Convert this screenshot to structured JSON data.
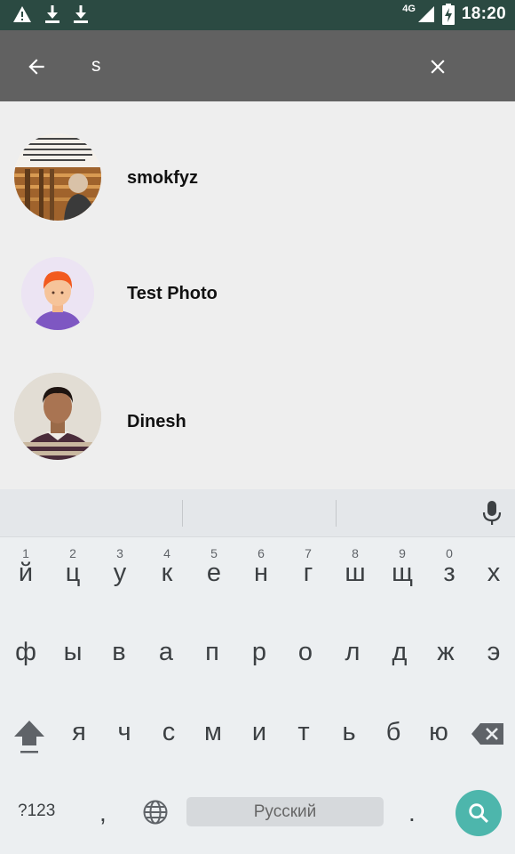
{
  "status_bar": {
    "network": "4G",
    "time": "18:20",
    "left_icons": [
      "warning-icon",
      "download-icon",
      "download-icon"
    ],
    "right_icons": [
      "signal-icon",
      "battery-charging-icon"
    ]
  },
  "toolbar": {
    "query": "s",
    "back_icon": "arrow-back-icon",
    "clear_icon": "close-icon"
  },
  "results": [
    {
      "name": "smokfyz"
    },
    {
      "name": "Test Photo"
    },
    {
      "name": "Dinesh"
    }
  ],
  "keyboard": {
    "row1": [
      {
        "ch": "й",
        "hint": "1"
      },
      {
        "ch": "ц",
        "hint": "2"
      },
      {
        "ch": "у",
        "hint": "3"
      },
      {
        "ch": "к",
        "hint": "4"
      },
      {
        "ch": "е",
        "hint": "5"
      },
      {
        "ch": "н",
        "hint": "6"
      },
      {
        "ch": "г",
        "hint": "7"
      },
      {
        "ch": "ш",
        "hint": "8"
      },
      {
        "ch": "щ",
        "hint": "9"
      },
      {
        "ch": "з",
        "hint": "0"
      },
      {
        "ch": "х",
        "hint": ""
      }
    ],
    "row2": [
      "ф",
      "ы",
      "в",
      "а",
      "п",
      "р",
      "о",
      "л",
      "д",
      "ж",
      "э"
    ],
    "row3": [
      "я",
      "ч",
      "с",
      "м",
      "и",
      "т",
      "ь",
      "б",
      "ю"
    ],
    "symbols_label": "?123",
    "comma": ",",
    "period": ".",
    "space_label": "Русский",
    "colors": {
      "accent": "#4db6ac",
      "toolbar": "#616161",
      "status_bar": "#2b4a42"
    }
  }
}
